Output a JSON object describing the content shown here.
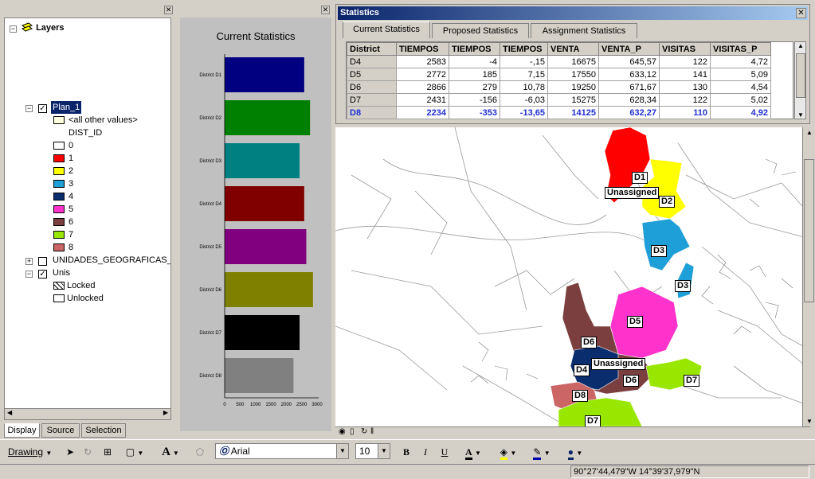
{
  "toc": {
    "root_label": "Layers",
    "layer1": {
      "name": "Plan_1",
      "other_values": "<all other values>",
      "field": "DIST_ID",
      "classes": [
        {
          "label": "0",
          "color": "#ffffff"
        },
        {
          "label": "1",
          "color": "#ff0000"
        },
        {
          "label": "2",
          "color": "#ffff00"
        },
        {
          "label": "3",
          "color": "#1f9fd8"
        },
        {
          "label": "4",
          "color": "#0a2d6e"
        },
        {
          "label": "5",
          "color": "#ff33cc"
        },
        {
          "label": "6",
          "color": "#7b3f3f"
        },
        {
          "label": "7",
          "color": "#99e600"
        },
        {
          "label": "8",
          "color": "#cc6666"
        }
      ]
    },
    "layer2": {
      "name": "UNIDADES_GEOGRAFICAS_Z6"
    },
    "layer3": {
      "name": "Unis",
      "locked": "Locked",
      "unlocked": "Unlocked"
    },
    "tabs": [
      "Display",
      "Source",
      "Selection"
    ]
  },
  "chart_data": {
    "type": "bar",
    "title": "Current Statistics",
    "categories": [
      "District D1",
      "District D2",
      "District D3",
      "District D4",
      "District D5",
      "District D6",
      "District D7",
      "District D8"
    ],
    "values": [
      2583,
      2772,
      2431,
      2583,
      2650,
      2866,
      2431,
      2234
    ],
    "colors": [
      "#000080",
      "#008000",
      "#008080",
      "#800000",
      "#800080",
      "#808000",
      "#000000",
      "#808080"
    ],
    "ticks": [
      "0",
      "500",
      "1000",
      "1500",
      "2000",
      "2500",
      "3000"
    ],
    "xlim": [
      0,
      3000
    ]
  },
  "stats": {
    "title": "Statistics",
    "tabs": [
      "Current Statistics",
      "Proposed Statistics",
      "Assignment Statistics"
    ],
    "columns": [
      "District",
      "TIEMPOS",
      "TIEMPOS",
      "TIEMPOS",
      "VENTA",
      "VENTA_P",
      "VISITAS",
      "VISITAS_P"
    ],
    "rows": [
      [
        "D4",
        "2583",
        "-4",
        "-,15",
        "16675",
        "645,57",
        "122",
        "4,72"
      ],
      [
        "D5",
        "2772",
        "185",
        "7,15",
        "17550",
        "633,12",
        "141",
        "5,09"
      ],
      [
        "D6",
        "2866",
        "279",
        "10,78",
        "19250",
        "671,67",
        "130",
        "4,54"
      ],
      [
        "D7",
        "2431",
        "-156",
        "-6,03",
        "15275",
        "628,34",
        "122",
        "5,02"
      ],
      [
        "D8",
        "2234",
        "-353",
        "-13,65",
        "14125",
        "632,27",
        "110",
        "4,92"
      ]
    ]
  },
  "map": {
    "labels": [
      "D1",
      "Unassigned",
      "D2",
      "D3",
      "D3",
      "D5",
      "D6",
      "Unassigned",
      "D4",
      "D6",
      "D7",
      "D8",
      "D7"
    ]
  },
  "drawbar": {
    "drawing_label": "Drawing",
    "font_name": "Arial",
    "font_size": "10",
    "bold": "B",
    "italic": "I",
    "underline": "U",
    "font_color_glyph": "A"
  },
  "status": {
    "coords": "90°27'44,479\"W  14°39'37,979\"N"
  }
}
